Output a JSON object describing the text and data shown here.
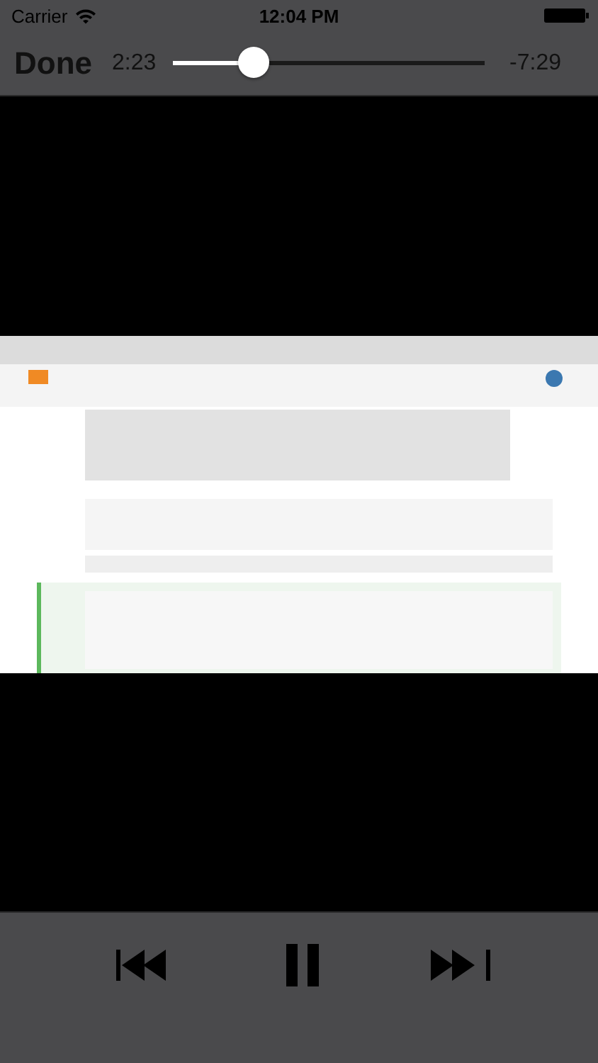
{
  "status_bar": {
    "carrier": "Carrier",
    "time": "12:04 PM"
  },
  "player": {
    "done_label": "Done",
    "elapsed": "2:23",
    "remaining": "-7:29",
    "level": 0.26
  },
  "controls": {
    "playing": true
  }
}
